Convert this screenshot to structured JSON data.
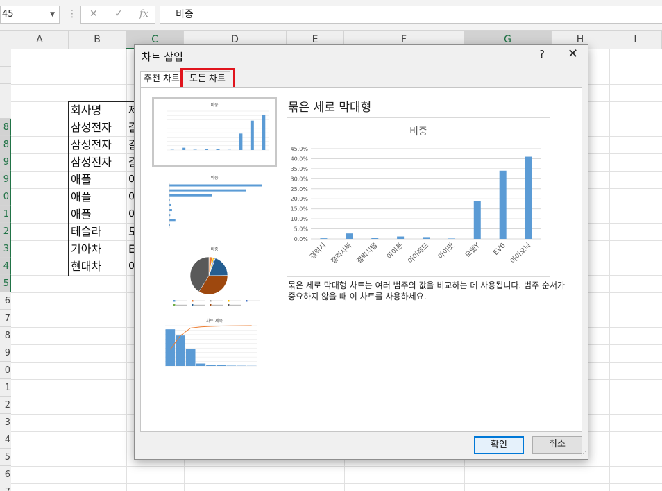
{
  "formula_bar": {
    "name_box": "45",
    "name_box_arrow": "▼",
    "separator": "⋮",
    "cancel_glyph": "✕",
    "enter_glyph": "✓",
    "fx_glyph": "fx",
    "formula": "비중"
  },
  "sheet": {
    "columns": [
      "A",
      "B",
      "C",
      "D",
      "E",
      "F",
      "G",
      "H",
      "I"
    ],
    "rows": [
      "",
      "",
      "",
      "",
      "8",
      "8",
      "9",
      "9",
      "0",
      "1",
      "2",
      "3",
      "4",
      "5",
      "6",
      "7",
      "8",
      "9",
      "0",
      "1",
      "2",
      "3",
      "4",
      "5",
      "6",
      "7"
    ],
    "cells": {
      "b_col": [
        "회사명",
        "삼성전자",
        "삼성전자",
        "삼성전자",
        "애플",
        "애플",
        "애플",
        "테슬라",
        "기아차",
        "현대차"
      ],
      "c_col": [
        "제",
        "갈",
        "갈",
        "갈",
        "아",
        "아",
        "아",
        "모",
        "E",
        "아"
      ]
    }
  },
  "dialog": {
    "title": "차트 삽입",
    "help": "?",
    "close": "✕",
    "tabs": {
      "recommended": "추천 차트",
      "all": "모든 차트"
    },
    "chart_heading": "묶은 세로 막대형",
    "description": "묶은 세로 막대형 차트는 여러 범주의 값을 비교하는 데 사용됩니다. 범주 순서가 중요하지 않을 때 이 차트를 사용하세요.",
    "ok_label": "확인",
    "cancel_label": "취소",
    "grip": "⋰",
    "thumbnails": {
      "bar_title": "비중",
      "hbar_title": "비중",
      "pie_title": "비중",
      "pareto_title": "차트 제목"
    }
  },
  "colors": {
    "bar": "#5b9bd5",
    "orange": "#ed7d31",
    "gray": "#a5a5a5",
    "dark": "#595959",
    "brown": "#9e480e",
    "highlight": "#e0141d"
  },
  "chart_data": {
    "type": "bar",
    "title": "비중",
    "categories": [
      "갤럭시",
      "갤럭시북",
      "갤럭시탭",
      "아이폰",
      "아이패드",
      "아이팟",
      "모델Y",
      "EV6",
      "아이오닉"
    ],
    "values": [
      0.3,
      2.7,
      0.4,
      1.2,
      0.9,
      0.2,
      19.0,
      34.0,
      41.0
    ],
    "yticks": [
      "0.0%",
      "5.0%",
      "10.0%",
      "15.0%",
      "20.0%",
      "25.0%",
      "30.0%",
      "35.0%",
      "40.0%",
      "45.0%"
    ],
    "ylim": [
      0,
      45
    ],
    "grid": true
  }
}
